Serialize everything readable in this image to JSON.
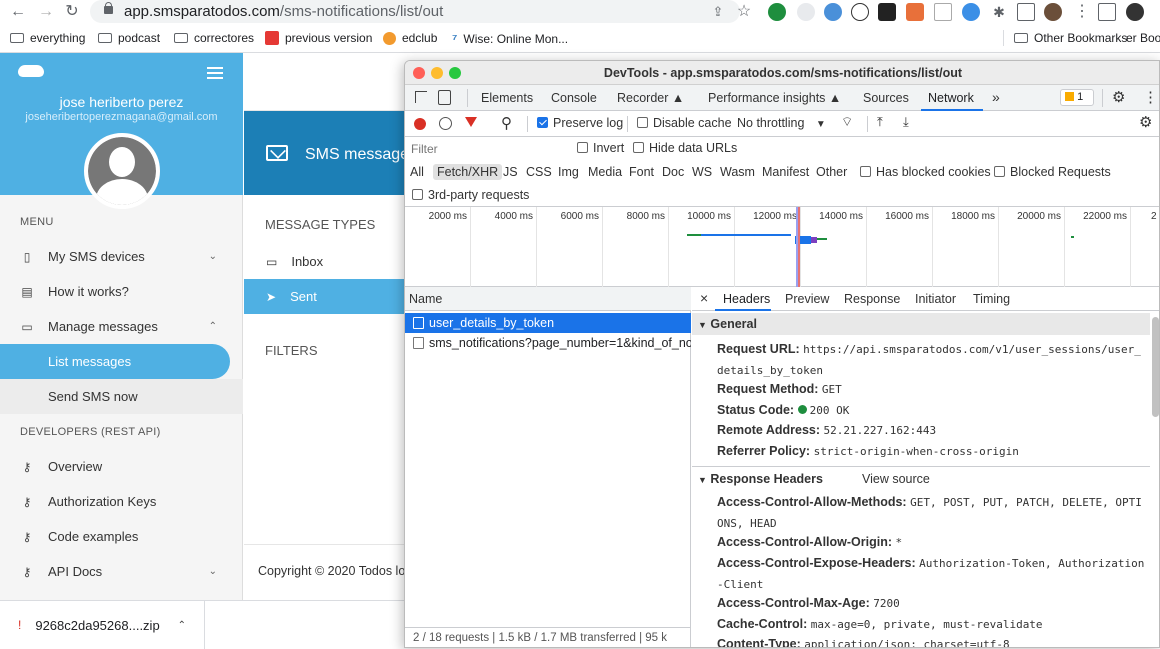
{
  "browser": {
    "url_host": "app.smsparatodos.com",
    "url_path": "/sms-notifications/list/out",
    "bookmarks": [
      "everything",
      "podcast",
      "correctores",
      "previous version",
      "edclub",
      "Wise: Online Mon...",
      "Other Bookmarks",
      "er Boo"
    ]
  },
  "sidebar": {
    "user_name": "jose heriberto perez",
    "user_email": "joseheribertoperezmagana@gmail.com",
    "menu_label": "MENU",
    "items": [
      {
        "label": "My SMS devices"
      },
      {
        "label": "How it works?"
      },
      {
        "label": "Manage messages"
      },
      {
        "label": "List messages"
      },
      {
        "label": "Send SMS now"
      }
    ],
    "dev_label": "DEVELOPERS (REST API)",
    "dev_items": [
      {
        "label": "Overview"
      },
      {
        "label": "Authorization Keys"
      },
      {
        "label": "Code examples"
      },
      {
        "label": "API Docs"
      }
    ]
  },
  "main": {
    "header_title": "SMS message",
    "message_types_label": "MESSAGE TYPES",
    "inbox_label": "Inbox",
    "sent_label": "Sent",
    "filters_label": "FILTERS",
    "footer_text": "Copyright © 2020 Todos lo"
  },
  "download": {
    "filename": "9268c2da95268....zip"
  },
  "devtools": {
    "title": "DevTools - app.smsparatodos.com/sms-notifications/list/out",
    "tabs": [
      "Elements",
      "Console",
      "Recorder",
      "Performance insights",
      "Sources",
      "Network",
      "»"
    ],
    "issues_count": "1",
    "toolbar": {
      "preserve_log": "Preserve log",
      "disable_cache": "Disable cache",
      "throttling": "No throttling"
    },
    "filter_placeholder": "Filter",
    "invert": "Invert",
    "hide_data_urls": "Hide data URLs",
    "type_filters": [
      "All",
      "Fetch/XHR",
      "JS",
      "CSS",
      "Img",
      "Media",
      "Font",
      "Doc",
      "WS",
      "Wasm",
      "Manifest",
      "Other"
    ],
    "has_blocked_cookies": "Has blocked cookies",
    "blocked_requests": "Blocked Requests",
    "third_party": "3rd-party requests",
    "timeline_ticks": [
      "2000 ms",
      "4000 ms",
      "6000 ms",
      "8000 ms",
      "10000 ms",
      "12000 ms",
      "14000 ms",
      "16000 ms",
      "18000 ms",
      "20000 ms",
      "22000 ms",
      "2"
    ],
    "table_header": "Name",
    "requests": [
      {
        "name": "user_details_by_token"
      },
      {
        "name": "sms_notifications?page_number=1&kind_of_no..."
      }
    ],
    "status_bar": "2 / 18 requests  |  1.5 kB / 1.7 MB transferred  |  95 k",
    "detail_tabs": [
      "×",
      "Headers",
      "Preview",
      "Response",
      "Initiator",
      "Timing"
    ],
    "general_label": "General",
    "general": {
      "request_url_key": "Request URL:",
      "request_url": "https://api.smsparatodos.com/v1/user_sessions/user_details_by_token",
      "method_key": "Request Method:",
      "method": "GET",
      "status_key": "Status Code:",
      "status": "200 OK",
      "remote_key": "Remote Address:",
      "remote": "52.21.227.162:443",
      "referrer_key": "Referrer Policy:",
      "referrer": "strict-origin-when-cross-origin"
    },
    "response_headers_label": "Response Headers",
    "view_source": "View source",
    "response_headers": [
      {
        "k": "Access-Control-Allow-Methods:",
        "v": "GET, POST, PUT, PATCH, DELETE, OPTIONS, HEAD"
      },
      {
        "k": "Access-Control-Allow-Origin:",
        "v": "*"
      },
      {
        "k": "Access-Control-Expose-Headers:",
        "v": "Authorization-Token, Authorization-Client"
      },
      {
        "k": "Access-Control-Max-Age:",
        "v": "7200"
      },
      {
        "k": "Cache-Control:",
        "v": "max-age=0, private, must-revalidate"
      },
      {
        "k": "Content-Type:",
        "v": "application/json; charset=utf-8"
      }
    ]
  }
}
